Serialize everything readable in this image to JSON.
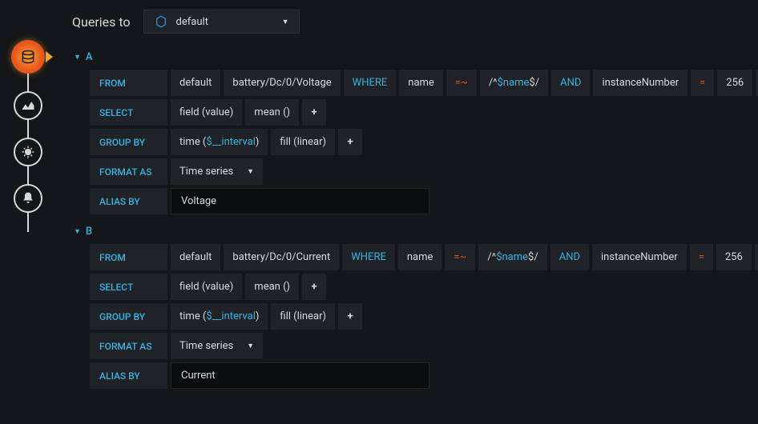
{
  "header": {
    "title": "Queries to",
    "datasource": "default"
  },
  "queries": [
    {
      "id": "A",
      "from": {
        "label": "FROM",
        "retention": "default",
        "measurement": "battery/Dc/0/Voltage",
        "where": "WHERE",
        "tag": "name",
        "op": "=~",
        "value_prefix": "/^",
        "value_var": "$name",
        "value_suffix": "$/",
        "and": "AND",
        "tag2": "instanceNumber",
        "op2": "=",
        "val2": "256"
      },
      "select": {
        "label": "SELECT",
        "field": "field (value)",
        "agg": "mean ()"
      },
      "groupby": {
        "label": "GROUP BY",
        "time_prefix": "time (",
        "time_var": "$__interval",
        "time_suffix": ")",
        "fill": "fill (linear)"
      },
      "format": {
        "label": "FORMAT AS",
        "value": "Time series"
      },
      "alias": {
        "label": "ALIAS BY",
        "value": "Voltage"
      }
    },
    {
      "id": "B",
      "from": {
        "label": "FROM",
        "retention": "default",
        "measurement": "battery/Dc/0/Current",
        "where": "WHERE",
        "tag": "name",
        "op": "=~",
        "value_prefix": "/^",
        "value_var": "$name",
        "value_suffix": "$/",
        "and": "AND",
        "tag2": "instanceNumber",
        "op2": "=",
        "val2": "256"
      },
      "select": {
        "label": "SELECT",
        "field": "field (value)",
        "agg": "mean ()"
      },
      "groupby": {
        "label": "GROUP BY",
        "time_prefix": "time (",
        "time_var": "$__interval",
        "time_suffix": ")",
        "fill": "fill (linear)"
      },
      "format": {
        "label": "FORMAT AS",
        "value": "Time series"
      },
      "alias": {
        "label": "ALIAS BY",
        "value": "Current"
      }
    }
  ],
  "plus": "+"
}
